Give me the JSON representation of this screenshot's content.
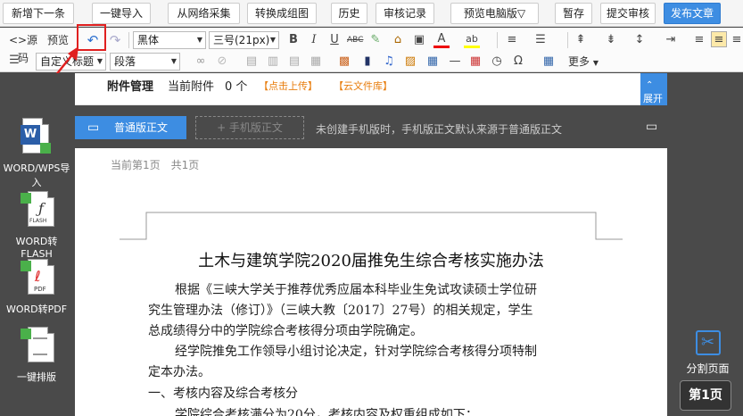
{
  "topbar": {
    "buttons": [
      "新增下一条",
      "一键导入",
      "从网络采集",
      "转换成组图",
      "历史",
      "审核记录",
      "预览电脑版▽",
      "暂存",
      "提交审核",
      "发布文章"
    ]
  },
  "toolbar": {
    "source_label": "源码",
    "preview_label": "预览",
    "font_family": "黑体",
    "font_size": "三号(21px)",
    "style_select": "自定义标题",
    "para_select": "段落",
    "more_label": "更多"
  },
  "sidebar": {
    "items": [
      "WORD/WPS导入",
      "WORD转FLASH",
      "WORD转PDF",
      "一键排版"
    ],
    "doc_labels": [
      "W",
      "FLASH",
      "PDF",
      ""
    ]
  },
  "attachments": {
    "label": "附件管理",
    "current": "当前附件",
    "count": "0 个",
    "upload": "【点击上传】",
    "cloud": "【云文件库】",
    "expand": "展开"
  },
  "version": {
    "pc_tab": "普通版正文",
    "mobile_tab": "+ 手机版正文",
    "note": "未创建手机版时，手机版正文默认来源于普通版正文"
  },
  "page": {
    "info": "当前第1页　共1页",
    "title": "土木与建筑学院2020届推免生综合考核实施办法",
    "paragraphs": [
      "根据《三峡大学关于推荐优秀应届本科毕业生免试攻读硕士学位研",
      "究生管理办法（修订）》（三峡大教〔2017〕27号）的相关规定，学生",
      "总成绩得分中的学院综合考核得分项由学院确定。",
      "经学院推免工作领导小组讨论决定，针对学院综合考核得分项特制",
      "定本办法。",
      "一、考核内容及综合考核分",
      "学院综合考核满分为20分，考核内容及权重组成如下："
    ]
  },
  "right": {
    "split_label": "分割页面",
    "page_label": "第1页"
  },
  "colors": {
    "accent": "#3d8de2",
    "highlight_box": "#e02020",
    "link_orange": "#e87d0d"
  }
}
